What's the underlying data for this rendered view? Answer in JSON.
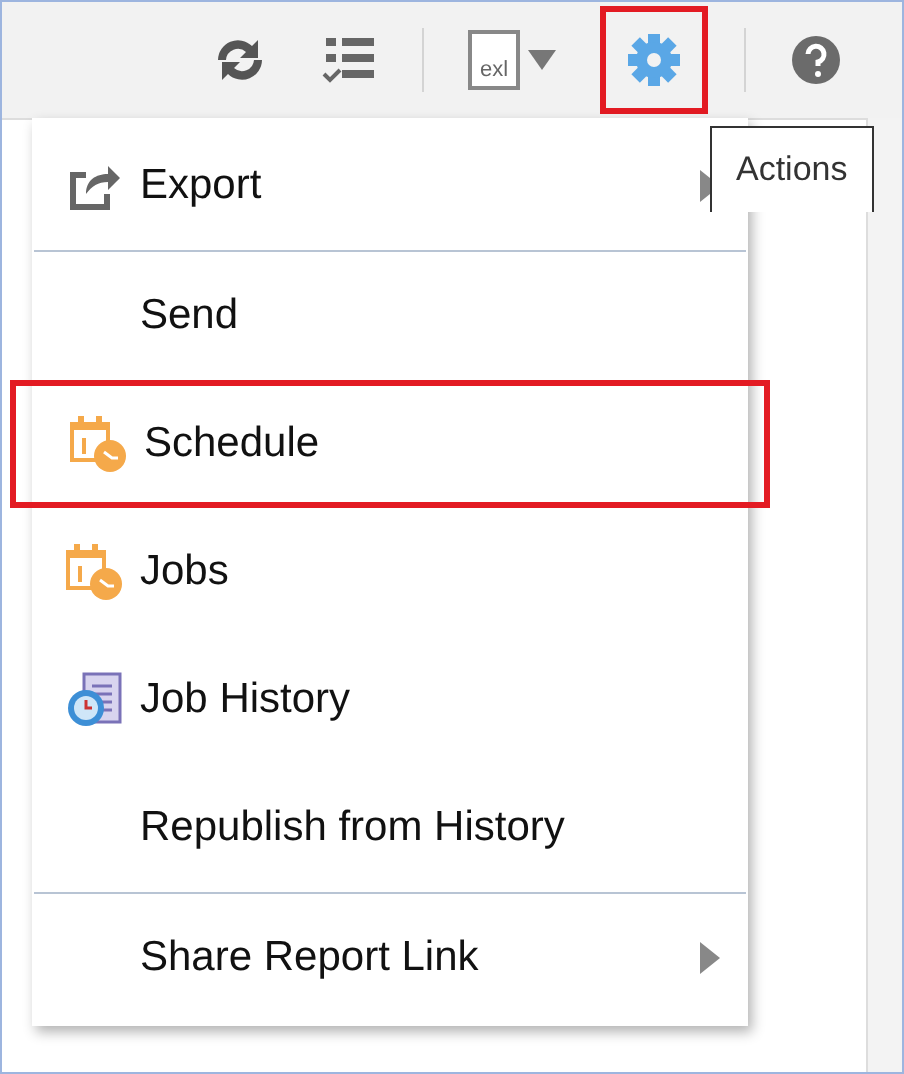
{
  "toolbar": {
    "groups": [
      {
        "buttons": [
          {
            "kind": "sync",
            "highlighted": false
          },
          {
            "kind": "checklist",
            "highlighted": false
          }
        ]
      },
      {
        "buttons": [
          {
            "kind": "excel",
            "label": "exl",
            "highlighted": false
          },
          {
            "kind": "gear",
            "highlighted": true
          }
        ]
      },
      {
        "buttons": [
          {
            "kind": "help",
            "highlighted": false
          }
        ]
      }
    ]
  },
  "tooltip": {
    "text": "Actions"
  },
  "menu": {
    "sections": [
      {
        "items": [
          {
            "label": "Export",
            "kind": "export",
            "submenu": true,
            "highlighted": false
          }
        ]
      },
      {
        "items": [
          {
            "label": "Send",
            "kind": "plain",
            "submenu": false,
            "highlighted": false
          },
          {
            "label": "Schedule",
            "kind": "calendar",
            "submenu": false,
            "highlighted": true
          },
          {
            "label": "Jobs",
            "kind": "calendar",
            "submenu": false,
            "highlighted": false
          },
          {
            "label": "Job History",
            "kind": "history",
            "submenu": false,
            "highlighted": false
          },
          {
            "label": "Republish from History",
            "kind": "plain",
            "submenu": false,
            "highlighted": false
          }
        ]
      },
      {
        "items": [
          {
            "label": "Share Report Link",
            "kind": "plain",
            "submenu": true,
            "highlighted": false
          }
        ]
      }
    ]
  }
}
